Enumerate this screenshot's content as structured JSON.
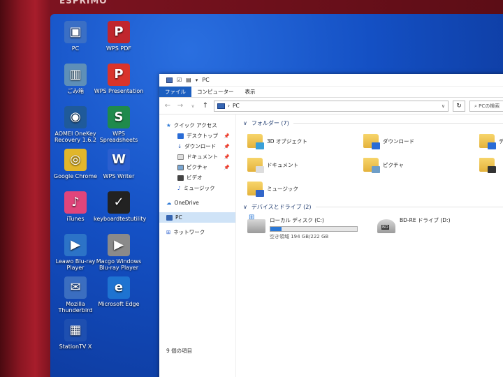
{
  "device": {
    "brand": "ESPRIMO"
  },
  "desktop": {
    "icons": [
      {
        "label": "PC",
        "color": "#3a6fc5",
        "glyph": "▣"
      },
      {
        "label": "WPS PDF",
        "color": "#c0262d",
        "glyph": "P"
      },
      {
        "label": "ごみ箱",
        "color": "#5e8fb8",
        "glyph": "▥"
      },
      {
        "label": "WPS Presentation",
        "color": "#d9342b",
        "glyph": "P"
      },
      {
        "label": "AOMEI OneKey Recovery 1.6.2",
        "color": "#1f5a9a",
        "glyph": "◉"
      },
      {
        "label": "WPS Spreadsheets",
        "color": "#1f8a4c",
        "glyph": "S"
      },
      {
        "label": "Google Chrome",
        "color": "#e1b62b",
        "glyph": "◎"
      },
      {
        "label": "WPS Writer",
        "color": "#2b5fcf",
        "glyph": "W"
      },
      {
        "label": "iTunes",
        "color": "#e0457b",
        "glyph": "♪"
      },
      {
        "label": "keyboardtestutility",
        "color": "#222222",
        "glyph": "✓"
      },
      {
        "label": "Leawo Blu-ray Player",
        "color": "#2c73c7",
        "glyph": "▶"
      },
      {
        "label": "Macgo Windows Blu-ray Player",
        "color": "#8a8a8a",
        "glyph": "▶"
      },
      {
        "label": "Mozilla Thunderbird",
        "color": "#3b6ec0",
        "glyph": "✉"
      },
      {
        "label": "Microsoft Edge",
        "color": "#1e73d1",
        "glyph": "e"
      },
      {
        "label": "StationTV X",
        "color": "#1e4fb0",
        "glyph": "▦"
      }
    ]
  },
  "explorer": {
    "title": "PC",
    "ribbon_tabs": [
      "ファイル",
      "コンピューター",
      "表示"
    ],
    "address": "PC",
    "search_placeholder": "PCの検索",
    "nav": {
      "quick_access": "クイック アクセス",
      "items": [
        "デスクトップ",
        "ダウンロード",
        "ドキュメント",
        "ピクチャ",
        "ビデオ",
        "ミュージック"
      ],
      "onedrive": "OneDrive",
      "pc": "PC",
      "network": "ネットワーク"
    },
    "folders_header": "フォルダー (7)",
    "folders": [
      {
        "label": "3D オブジェクト",
        "badge": "#3aa0d8"
      },
      {
        "label": "ダウンロード",
        "badge": "#2a6cd6"
      },
      {
        "label": "デ",
        "badge": "#2a6cd6"
      },
      {
        "label": "ドキュメント",
        "badge": "#dddddd"
      },
      {
        "label": "ピクチャ",
        "badge": "#6e9ec8"
      },
      {
        "label": "",
        "badge": "#333333"
      },
      {
        "label": "ミュージック",
        "badge": "#3266c9"
      }
    ],
    "drives_header": "デバイスとドライブ (2)",
    "drives": [
      {
        "name": "ローカル ディスク (C:)",
        "free_text": "空き領域 194 GB/222 GB",
        "used_fraction": 0.13
      },
      {
        "name": "BD-RE ドライブ (D:)"
      }
    ],
    "status": "9 個の項目"
  }
}
